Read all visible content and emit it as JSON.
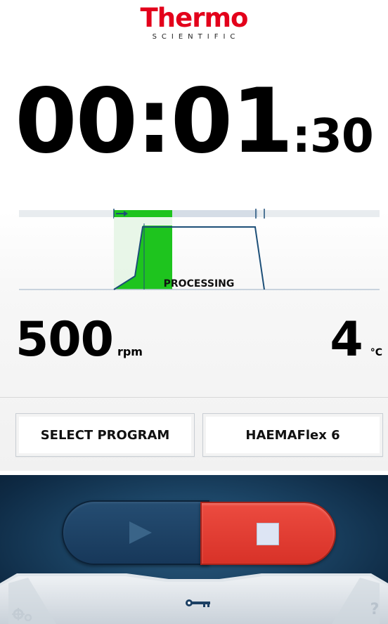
{
  "brand": {
    "name": "Thermo",
    "sub": "SCIENTIFIC",
    "color": "#e3001b"
  },
  "timer": {
    "hours_minutes": "00:01",
    "seconds": ":30"
  },
  "profile": {
    "status": "PROCESSING",
    "progress_color": "#1ec41e",
    "line_color": "#1d4f78"
  },
  "readings": {
    "speed": {
      "value": "500",
      "unit": "rpm"
    },
    "temperature": {
      "value": "4",
      "unit": "°C"
    }
  },
  "buttons": {
    "select_program": "SELECT PROGRAM",
    "current_program": "HAEMAFlex 6"
  },
  "controls": {
    "start_icon": "play-icon",
    "stop_icon": "stop-icon",
    "stop_color": "#e2382e",
    "lock_icon": "key-icon",
    "settings_icon": "gears-icon",
    "help_label": "?"
  }
}
